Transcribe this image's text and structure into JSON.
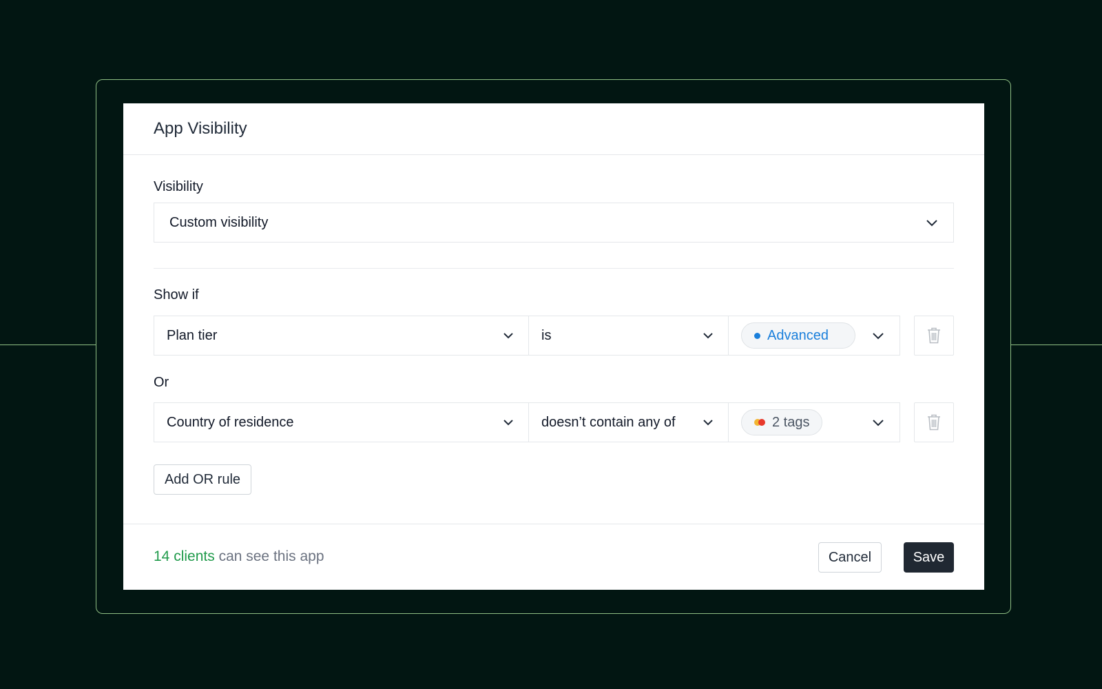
{
  "modal": {
    "title": "App Visibility"
  },
  "visibility": {
    "label": "Visibility",
    "value": "Custom visibility"
  },
  "rules": [
    {
      "connector": "Show if",
      "field": "Plan tier",
      "operator": "is",
      "value_pill": "Advanced",
      "value_dot_colors": [
        "#1a7fdb"
      ]
    },
    {
      "connector": "Or",
      "field": "Country of residence",
      "operator": "doesn’t contain any of",
      "value_pill": "2 tags",
      "value_dot_colors": [
        "#f2b632",
        "#e8392b"
      ]
    }
  ],
  "add_rule_label": "Add OR rule",
  "footer": {
    "count_text": "14 clients",
    "suffix_text": "can see this app",
    "cancel_label": "Cancel",
    "save_label": "Save"
  },
  "colors": {
    "background": "#021612",
    "frame_border": "#8fbf84",
    "accent_green": "#1f9a4a",
    "pill_blue_text": "#1a7fdb",
    "save_bg": "#202832"
  },
  "icons": {
    "dropdown": "chevron-down-icon",
    "delete": "trash-icon"
  }
}
